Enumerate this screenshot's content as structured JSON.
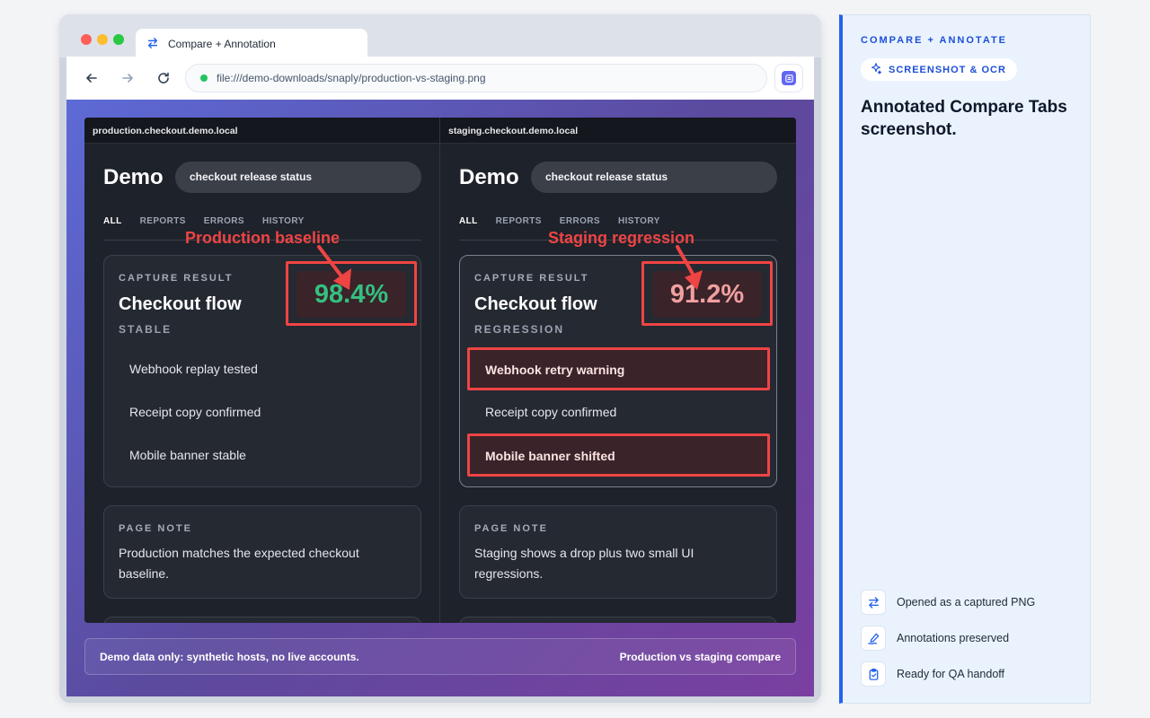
{
  "browser": {
    "tab_title": "Compare + Annotation",
    "url": "file:///demo-downloads/snaply/production-vs-staging.png"
  },
  "panes": [
    {
      "host": "production.checkout.demo.local",
      "brand": "Demo",
      "search_value": "checkout release status",
      "nav_tabs": [
        "ALL",
        "REPORTS",
        "ERRORS",
        "HISTORY"
      ],
      "active_tab": "ALL",
      "callout": "Production baseline",
      "card": {
        "kicker": "CAPTURE RESULT",
        "title": "Checkout flow",
        "status": "STABLE",
        "score": "98.4%",
        "score_color": "#34c080",
        "checks": [
          "Webhook replay tested",
          "Receipt copy confirmed",
          "Mobile banner stable"
        ],
        "flagged_checks": []
      },
      "note": {
        "kicker": "PAGE NOTE",
        "text": "Production matches the expected checkout baseline."
      }
    },
    {
      "host": "staging.checkout.demo.local",
      "brand": "Demo",
      "search_value": "checkout release status",
      "nav_tabs": [
        "ALL",
        "REPORTS",
        "ERRORS",
        "HISTORY"
      ],
      "active_tab": "ALL",
      "callout": "Staging regression",
      "card": {
        "kicker": "CAPTURE RESULT",
        "title": "Checkout flow",
        "status": "REGRESSION",
        "score": "91.2%",
        "score_color": "#f0a0a0",
        "checks": [
          "Webhook retry warning",
          "Receipt copy confirmed",
          "Mobile banner shifted"
        ],
        "flagged_checks": [
          "Webhook retry warning",
          "Mobile banner shifted"
        ]
      },
      "note": {
        "kicker": "PAGE NOTE",
        "text": "Staging shows a drop plus two small UI regressions."
      }
    }
  ],
  "footer": {
    "left": "Demo data only: synthetic hosts, no live accounts.",
    "right": "Production vs staging compare"
  },
  "side": {
    "kicker": "COMPARE + ANNOTATE",
    "pill": "SCREENSHOT & OCR",
    "title": "Annotated Compare Tabs screenshot.",
    "items": [
      {
        "label": "Opened as a captured PNG",
        "icon": "swap-arrows-icon"
      },
      {
        "label": "Annotations preserved",
        "icon": "pen-signature-icon"
      },
      {
        "label": "Ready for QA handoff",
        "icon": "clipboard-check-icon"
      }
    ]
  },
  "colors": {
    "annotation": "#ef4444",
    "accent": "#2563eb",
    "good": "#34c080",
    "bad": "#f0a0a0"
  }
}
